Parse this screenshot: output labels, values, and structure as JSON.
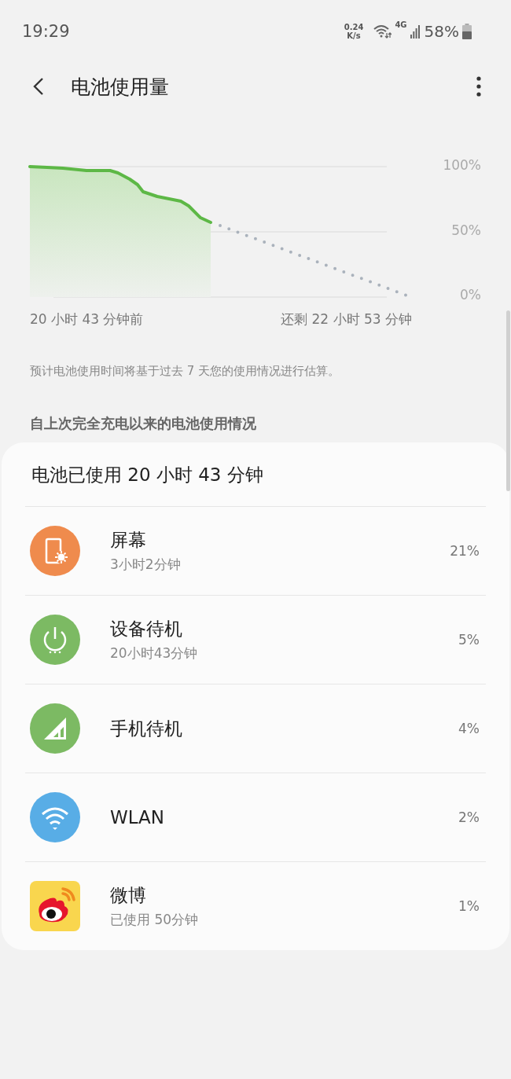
{
  "status_bar": {
    "time": "19:29",
    "speed_value": "0.24",
    "speed_unit": "K/s",
    "network": "4G",
    "battery": "58%"
  },
  "header": {
    "title": "电池使用量"
  },
  "chart": {
    "yticks": [
      "100%",
      "50%",
      "0%"
    ],
    "start_label": "20 小时 43 分钟前",
    "end_label": "还剩 22 小时 53 分钟"
  },
  "note": "预计电池使用时间将基于过去 7 天您的使用情况进行估算。",
  "section_title": "自上次完全充电以来的电池使用情况",
  "card": {
    "title": "电池已使用 20 小时 43 分钟",
    "items": [
      {
        "kind": "screen",
        "color": "#ef8b4d",
        "name": "屏幕",
        "detail": "3小时2分钟",
        "percent": "21%"
      },
      {
        "kind": "standby",
        "color": "#7cba63",
        "name": "设备待机",
        "detail": "20小时43分钟",
        "percent": "5%"
      },
      {
        "kind": "cell",
        "color": "#7cba63",
        "name": "手机待机",
        "percent": "4%"
      },
      {
        "kind": "wifi",
        "color": "#58ade6",
        "name": "WLAN",
        "percent": "2%"
      },
      {
        "kind": "weibo",
        "color": "#f9d64e",
        "name": "微博",
        "detail": "已使用 50分钟",
        "percent": "1%"
      }
    ]
  }
}
